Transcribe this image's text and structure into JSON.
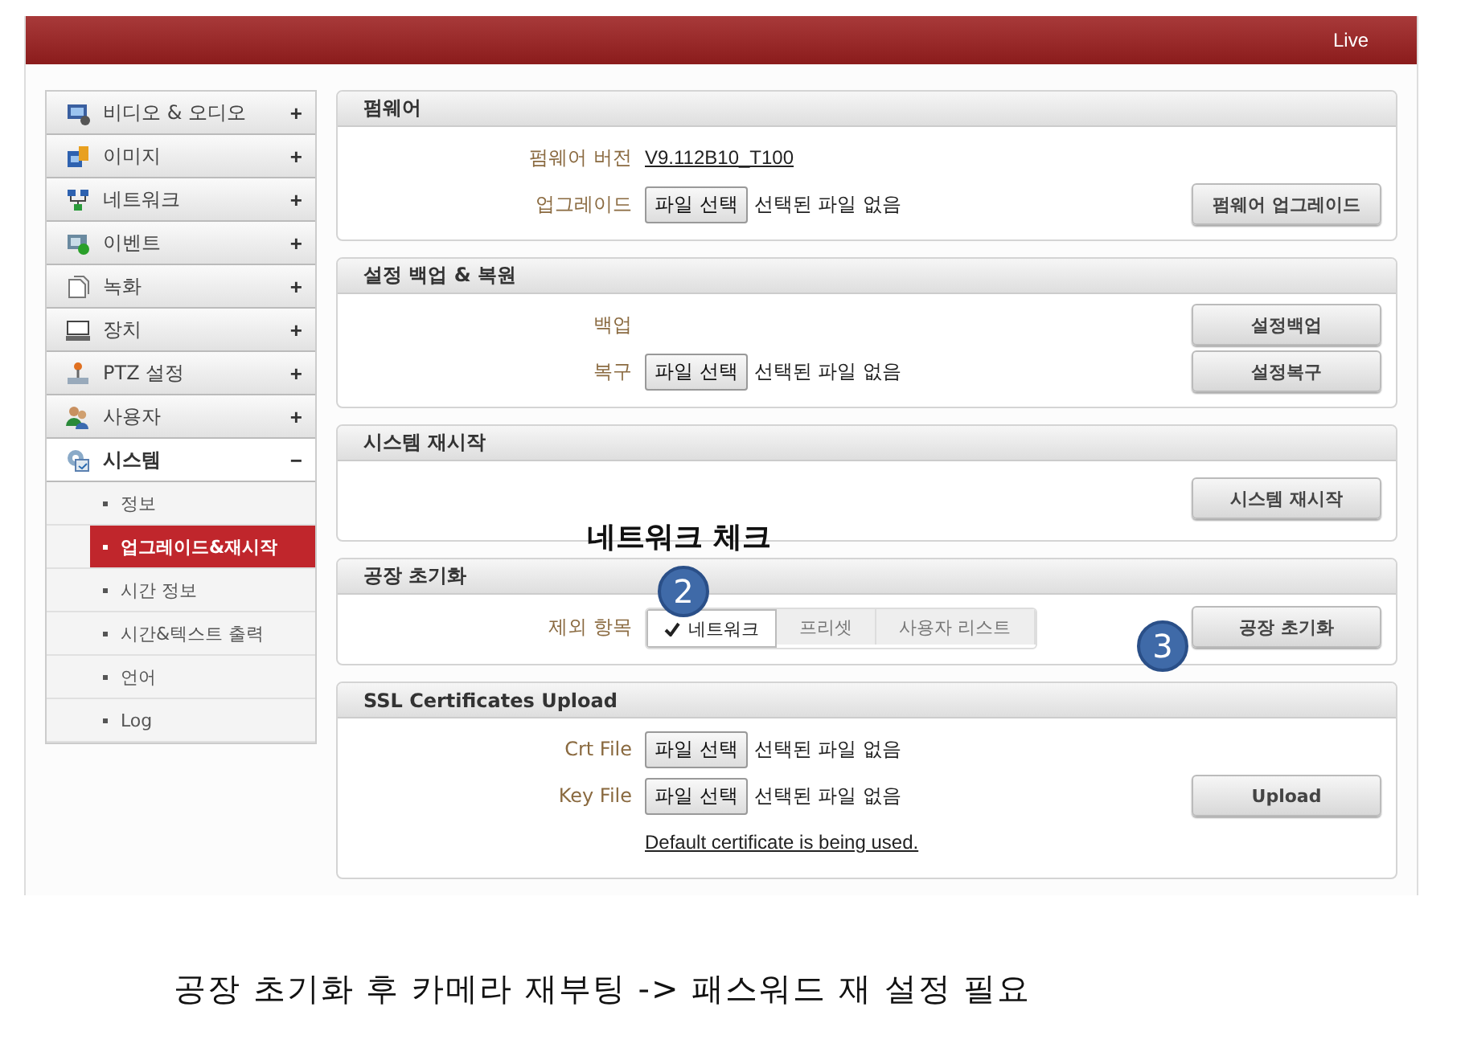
{
  "header": {
    "live": "Live"
  },
  "sidebar": {
    "items": [
      {
        "label": "비디오 & 오디오",
        "toggle": "+",
        "expanded": false
      },
      {
        "label": "이미지",
        "toggle": "+",
        "expanded": false
      },
      {
        "label": "네트워크",
        "toggle": "+",
        "expanded": false
      },
      {
        "label": "이벤트",
        "toggle": "+",
        "expanded": false
      },
      {
        "label": "녹화",
        "toggle": "+",
        "expanded": false
      },
      {
        "label": "장치",
        "toggle": "+",
        "expanded": false
      },
      {
        "label": "PTZ 설정",
        "toggle": "+",
        "expanded": false
      },
      {
        "label": "사용자",
        "toggle": "+",
        "expanded": false
      },
      {
        "label": "시스템",
        "toggle": "−",
        "expanded": true,
        "children": [
          {
            "label": "정보",
            "selected": false
          },
          {
            "label": "업그레이드&재시작",
            "selected": true
          },
          {
            "label": "시간 정보",
            "selected": false
          },
          {
            "label": "시간&텍스트 출력",
            "selected": false
          },
          {
            "label": "언어",
            "selected": false
          },
          {
            "label": "Log",
            "selected": false
          }
        ]
      }
    ]
  },
  "sections": [
    {
      "title": "펌웨어",
      "rows": [
        {
          "kind": "value",
          "label": "펌웨어 버전",
          "value": "V9.112B10_T100"
        },
        {
          "kind": "file",
          "label": "업그레이드",
          "file_button": "파일 선택",
          "status": "선택된 파일 없음",
          "button": "펌웨어 업그레이드"
        }
      ]
    },
    {
      "title": "설정 백업 & 복원",
      "rows": [
        {
          "kind": "plain",
          "label": "백업",
          "button": "설정백업"
        },
        {
          "kind": "file",
          "label": "복구",
          "file_button": "파일 선택",
          "status": "선택된 파일 없음",
          "button": "설정복구"
        }
      ]
    },
    {
      "title": "시스템 재시작",
      "rows": [
        {
          "kind": "plain",
          "button": "시스템 재시작"
        }
      ]
    },
    {
      "title": "공장 초기화",
      "rows": [
        {
          "kind": "toggle",
          "label": "제외 항목",
          "options": [
            {
              "label": "네트워크",
              "selected": true
            },
            {
              "label": "프리셋",
              "selected": false
            },
            {
              "label": "사용자 리스트",
              "selected": false
            }
          ],
          "button": "공장 초기화"
        }
      ]
    },
    {
      "title": "SSL Certificates Upload",
      "rows": [
        {
          "kind": "file",
          "label": "Crt File",
          "file_button": "파일 선택",
          "status": "선택된 파일 없음"
        },
        {
          "kind": "file",
          "label": "Key File",
          "file_button": "파일 선택",
          "status": "선택된 파일 없음",
          "button": "Upload"
        },
        {
          "kind": "note",
          "value": "Default certificate is being used."
        }
      ]
    }
  ],
  "annotations": [
    {
      "kind": "note",
      "text": "네트워크 체크"
    },
    {
      "kind": "badge",
      "text": "2"
    },
    {
      "kind": "badge",
      "text": "3"
    }
  ],
  "caption": "공장 초기화 후 카메라 재부팅 -> 패스워드 재 설정 필요"
}
